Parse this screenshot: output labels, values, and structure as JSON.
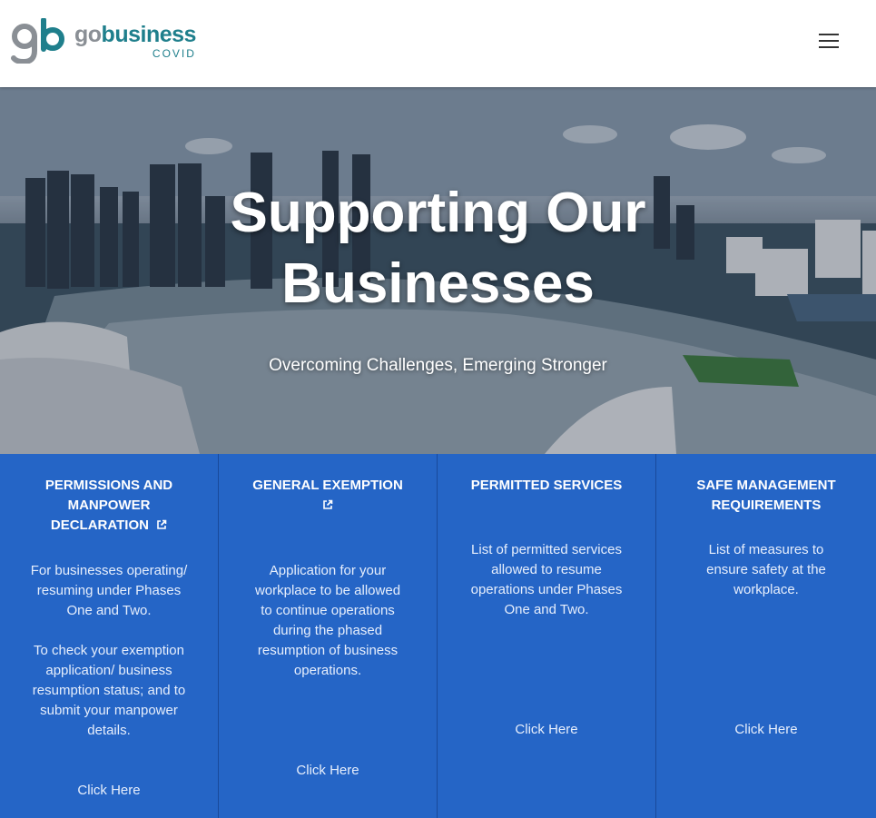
{
  "header": {
    "logo": {
      "mark": "gb",
      "word_go": "go",
      "word_business": "business",
      "sub": "COVID"
    },
    "menu_icon": "hamburger-icon"
  },
  "hero": {
    "title_line1": "Supporting Our",
    "title_line2": "Businesses",
    "subtitle": "Overcoming Challenges, Emerging Stronger"
  },
  "cards": [
    {
      "title": "PERMISSIONS AND MANPOWER DECLARATION",
      "external_link_icon": true,
      "description": [
        "For businesses operating/ resuming under Phases One and Two.",
        "To check your exemption application/ business resumption status; and to submit your manpower details."
      ],
      "link": "Click Here"
    },
    {
      "title": "GENERAL EXEMPTION",
      "external_link_icon": true,
      "description": [
        "Application for your workplace to be allowed to continue operations during the phased resumption of business operations."
      ],
      "link": "Click Here"
    },
    {
      "title": "PERMITTED SERVICES",
      "external_link_icon": false,
      "description": [
        "List of permitted services allowed to resume operations under Phases One and Two."
      ],
      "link": "Click Here"
    },
    {
      "title": "SAFE MANAGEMENT REQUIREMENTS",
      "external_link_icon": false,
      "description": [
        "List of measures to ensure safety at the workplace."
      ],
      "link": "Click Here"
    }
  ],
  "colors": {
    "brand_teal": "#1f7f8c",
    "brand_grey": "#8a8f95",
    "card_blue": "#2565c6"
  }
}
